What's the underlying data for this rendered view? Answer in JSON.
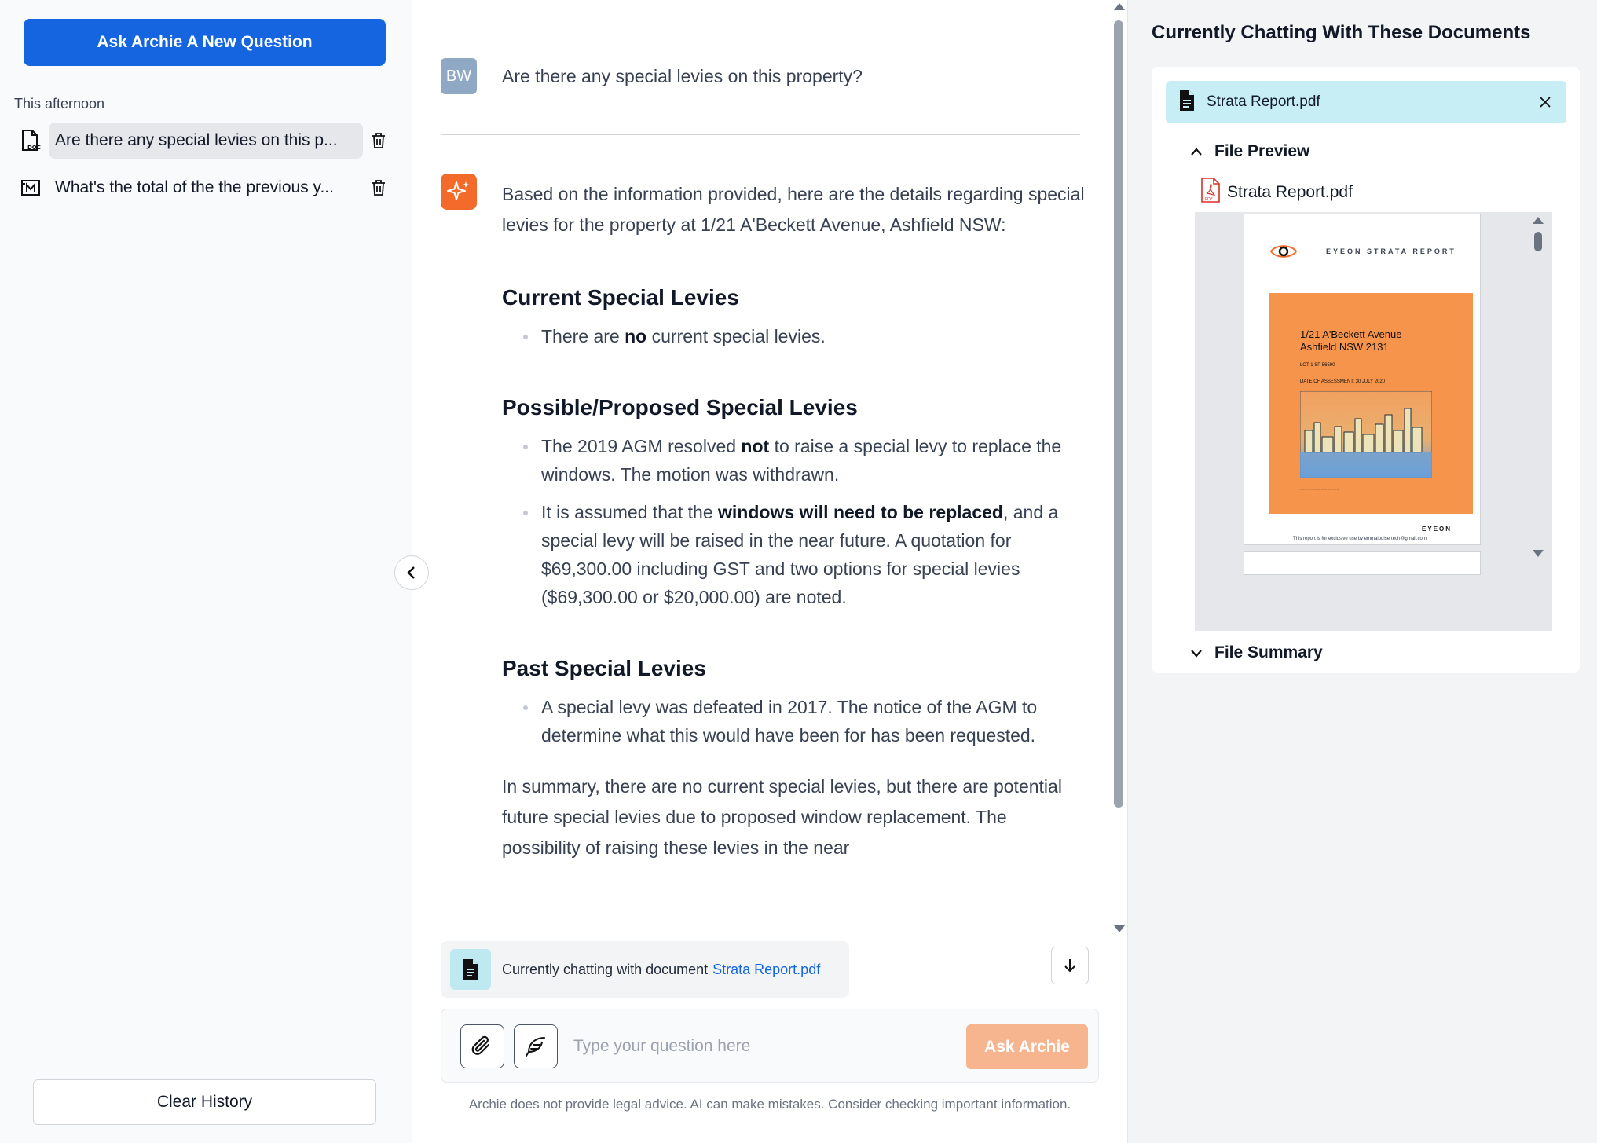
{
  "sidebar": {
    "new_question_label": "Ask Archie A New Question",
    "group_label": "This afternoon",
    "history": [
      {
        "label": "Are there any special levies on this p...",
        "icon": "doc-file-icon"
      },
      {
        "label": "What's the total of the the previous y...",
        "icon": "mail-file-icon"
      }
    ],
    "clear_history_label": "Clear History"
  },
  "chat": {
    "user_initials": "BW",
    "user_question": "Are there any special levies on this property?",
    "answer": {
      "intro": "Based on the information provided, here are the details regarding special levies for the property at 1/21 A'Beckett Avenue, Ashfield NSW:",
      "sections": [
        {
          "heading": "Current Special Levies",
          "bullets": [
            {
              "pre": "There are ",
              "bold": "no",
              "post": " current special levies."
            }
          ]
        },
        {
          "heading": "Possible/Proposed Special Levies",
          "bullets": [
            {
              "pre": "The 2019 AGM resolved ",
              "bold": "not",
              "post": " to raise a special levy to replace the windows. The motion was withdrawn."
            },
            {
              "pre": "It is assumed that the ",
              "bold": "windows will need to be replaced",
              "post": ", and a special levy will be raised in the near future. A quotation for $69,300.00 including GST and two options for special levies ($69,300.00 or $20,000.00) are noted."
            }
          ]
        },
        {
          "heading": "Past Special Levies",
          "bullets": [
            {
              "pre": "A special levy was defeated in 2017. The notice of the AGM to determine what this would have been for has been requested.",
              "bold": "",
              "post": ""
            }
          ]
        }
      ],
      "summary": "In summary, there are no current special levies, but there are potential future special levies due to proposed window replacement. The possibility of raising these levies in the near"
    },
    "doc_chip_text": "Currently chatting with document",
    "doc_chip_link": "Strata Report.pdf",
    "input_placeholder": "Type your question here",
    "input_value": "",
    "ask_button_label": "Ask Archie",
    "disclaimer": "Archie does not provide legal advice. AI can make mistakes. Consider checking important information."
  },
  "right_panel": {
    "title": "Currently Chatting With These Documents",
    "doc_tab_name": "Strata Report.pdf",
    "file_preview_label": "File Preview",
    "preview_file_name": "Strata Report.pdf",
    "file_summary_label": "File Summary",
    "preview_page": {
      "brand": "EYEON STRATA REPORT",
      "address_line1": "1/21 A'Beckett Avenue",
      "address_line2": "Ashfield NSW 2131",
      "lot_line": "LOT 1       SP 56590",
      "date_line": "DATE OF ASSESSMENT: 30 JULY 2020",
      "logo_text": "EYEON",
      "footer_line": "This report is for exclusive use by emmalouisertech@gmail.com"
    }
  },
  "colors": {
    "primary_blue": "#1565e0",
    "accent_orange": "#f26b2a",
    "ask_button": "#f6b48f",
    "doc_tab_bg": "#c7eef4"
  }
}
